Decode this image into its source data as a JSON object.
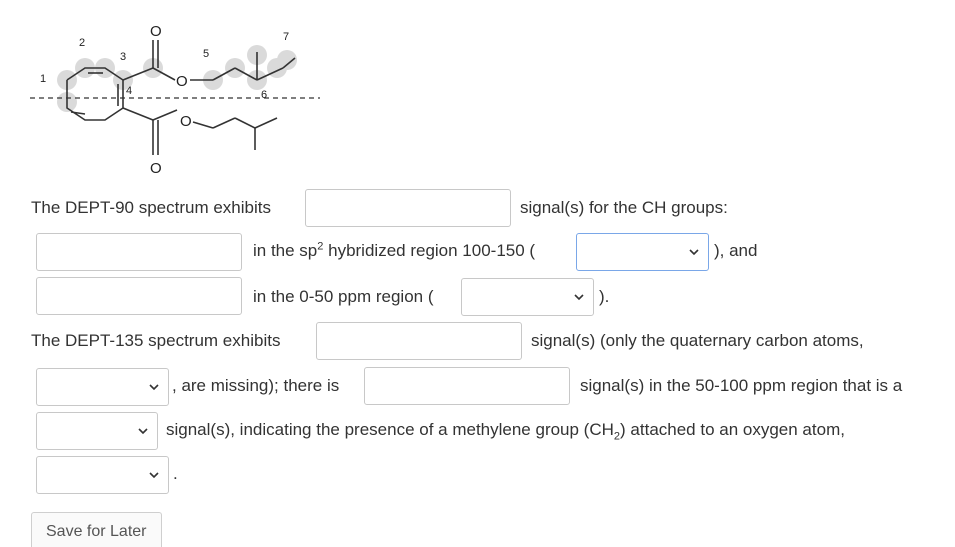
{
  "structure": {
    "labels": [
      "2",
      "3",
      "1",
      "4",
      "5",
      "6",
      "7"
    ],
    "atoms": [
      "O",
      "O",
      "O",
      "O"
    ]
  },
  "q": {
    "dept90_prefix": "The DEPT-90 spectrum exhibits",
    "dept90_suffix": "signal(s) for the CH groups:",
    "sp2_pre": "in the sp",
    "sp2_sup": "2",
    "sp2_post": " hybridized region 100-150 (",
    "and_text": "), and",
    "region050": "in the 0-50 ppm region (",
    "paren_close": ").",
    "dept135_prefix": "The DEPT-135 spectrum exhibits",
    "dept135_suffix": "signal(s) (only the quaternary carbon atoms,",
    "missing_text": ", are missing); there is",
    "region50100": "signal(s) in the 50-100 ppm region that is a",
    "methylene_pre": "signal(s), indicating the presence of a methylene group (CH",
    "methylene_sub": "2",
    "methylene_post": ") attached to an oxygen atom,",
    "period": "."
  },
  "buttons": {
    "save": "Save for Later"
  },
  "colors": {
    "highlight": "#d6d6d6",
    "active_border": "#7aa7e8",
    "border": "#c8c8c8"
  }
}
